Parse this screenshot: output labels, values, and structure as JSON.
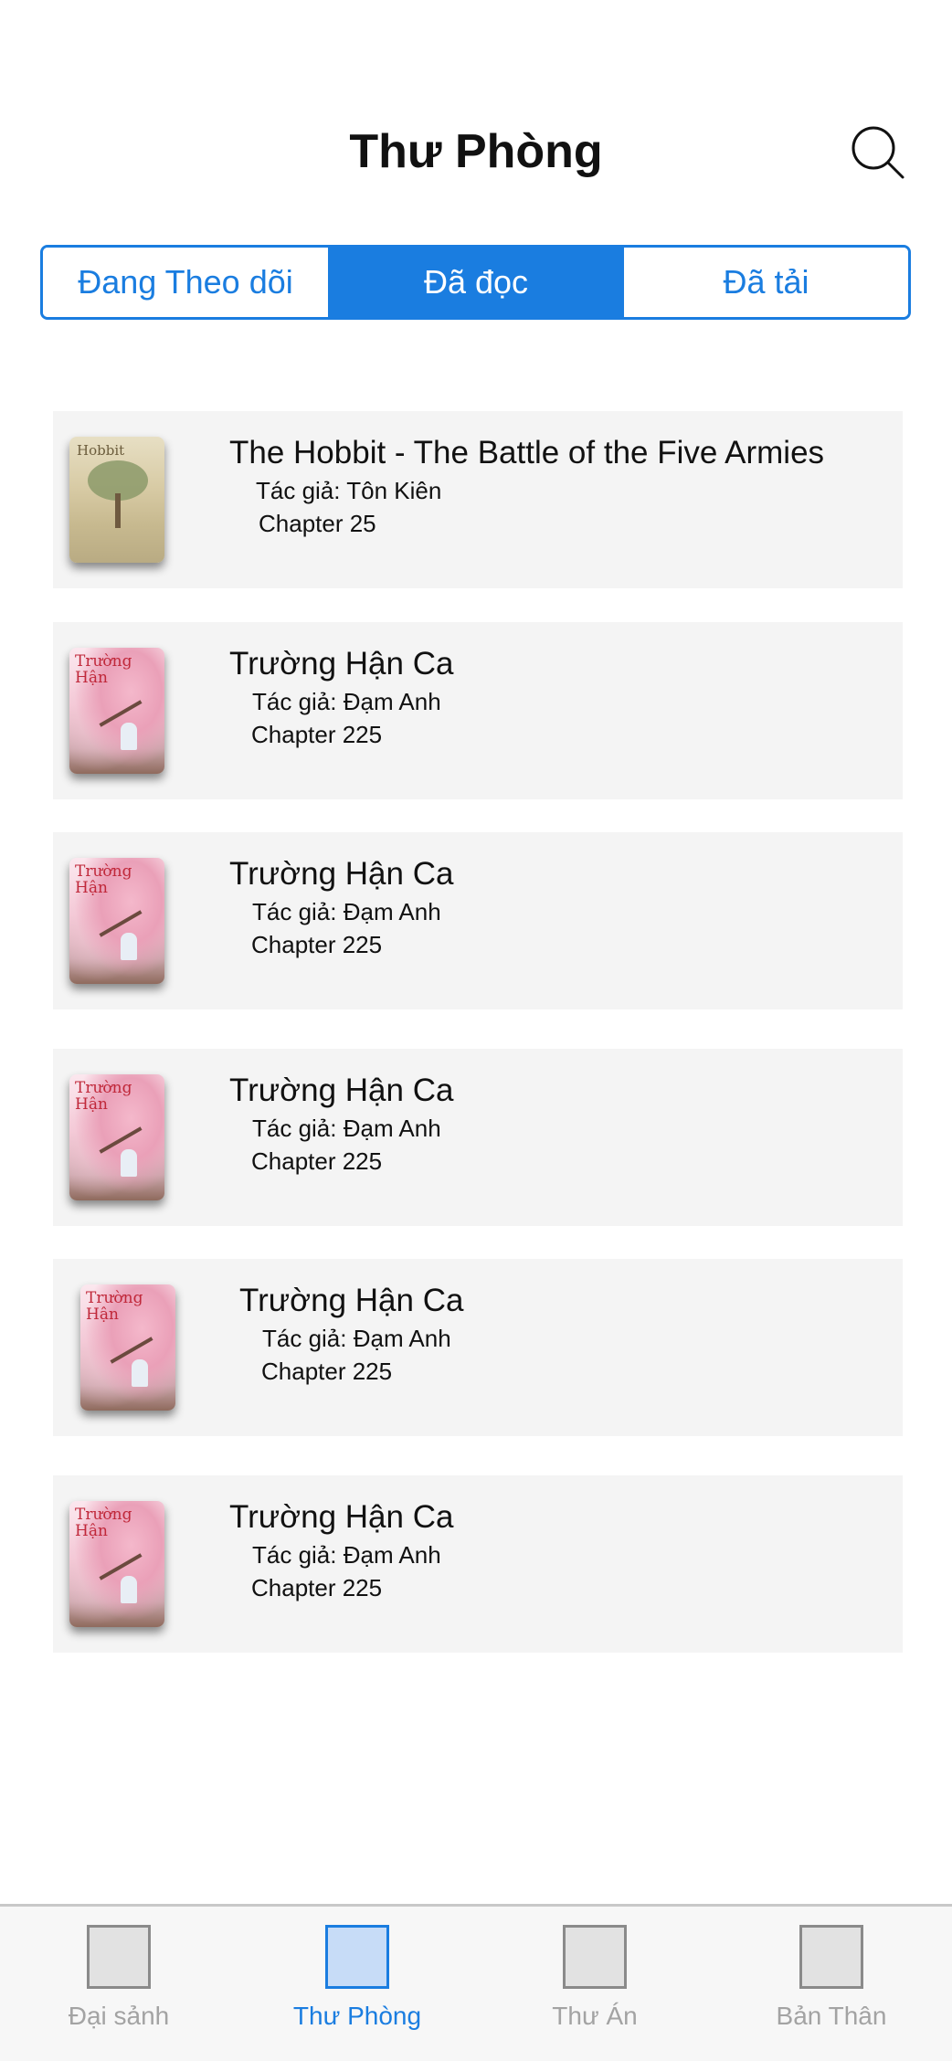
{
  "header": {
    "title": "Thư Phòng",
    "search_icon": "search-icon"
  },
  "tabs": [
    {
      "label": "Đang Theo dõi",
      "active": false
    },
    {
      "label": "Đã đọc",
      "active": true
    },
    {
      "label": "Đã tải",
      "active": false
    }
  ],
  "books": [
    {
      "title": "The Hobbit - The Battle of the Five Armies",
      "author": "Tác giả: Tôn Kiên",
      "chapter": "Chapter 25",
      "cover": "hobbit-cover"
    },
    {
      "title": "Trường Hận Ca",
      "author": "Tác giả: Đạm Anh",
      "chapter": "Chapter 225",
      "cover": "truong-han-ca-cover"
    },
    {
      "title": "Trường Hận Ca",
      "author": "Tác giả: Đạm Anh",
      "chapter": "Chapter 225",
      "cover": "truong-han-ca-cover"
    },
    {
      "title": "Trường Hận Ca",
      "author": "Tác giả: Đạm Anh",
      "chapter": "Chapter 225",
      "cover": "truong-han-ca-cover"
    },
    {
      "title": "Trường Hận Ca",
      "author": "Tác giả: Đạm Anh",
      "chapter": "Chapter 225",
      "cover": "truong-han-ca-cover"
    },
    {
      "title": "Trường Hận Ca",
      "author": "Tác giả: Đạm Anh",
      "chapter": "Chapter 225",
      "cover": "truong-han-ca-cover"
    }
  ],
  "bottom_nav": [
    {
      "label": "Đại sảnh",
      "active": false
    },
    {
      "label": "Thư Phòng",
      "active": true
    },
    {
      "label": "Thư Án",
      "active": false
    },
    {
      "label": "Bản Thân",
      "active": false
    }
  ],
  "colors": {
    "accent": "#1a7de0",
    "card_background": "#f4f4f4",
    "inactive_nav": "#a3a3a3"
  }
}
